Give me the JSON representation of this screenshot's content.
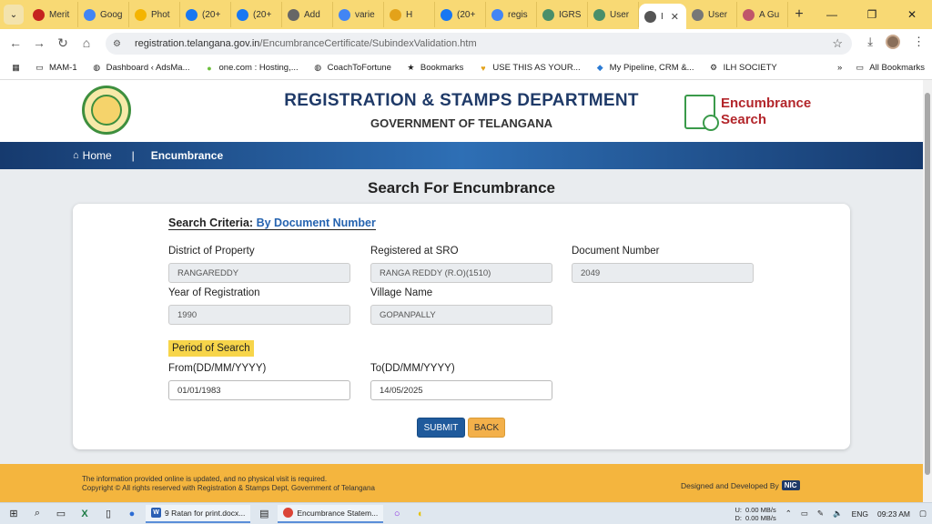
{
  "browser": {
    "tabs": [
      {
        "label": "Merit",
        "icon": "gmail-icon",
        "color": "#c5221f"
      },
      {
        "label": "Goog",
        "icon": "google-icon",
        "color": "#4285f4"
      },
      {
        "label": "Phot",
        "icon": "photos-icon",
        "color": "#f4b400"
      },
      {
        "label": "(20+",
        "icon": "facebook-icon",
        "color": "#1877f2"
      },
      {
        "label": "(20+",
        "icon": "facebook-icon",
        "color": "#1877f2"
      },
      {
        "label": "Add",
        "icon": "globe-icon",
        "color": "#666666"
      },
      {
        "label": "varie",
        "icon": "google-icon",
        "color": "#4285f4"
      },
      {
        "label": "H",
        "icon": "filter-icon",
        "color": "#e3a21a"
      },
      {
        "label": "(20+",
        "icon": "facebook-icon",
        "color": "#1877f2"
      },
      {
        "label": "regis",
        "icon": "google-icon",
        "color": "#4285f4"
      },
      {
        "label": "IGRS",
        "icon": "globe-icon",
        "color": "#4a8f6a"
      },
      {
        "label": "User",
        "icon": "globe-icon",
        "color": "#4a8f6a"
      },
      {
        "label": "I",
        "icon": "globe-icon",
        "color": "#555555",
        "active": true
      },
      {
        "label": "User",
        "icon": "loading-icon",
        "color": "#777777"
      },
      {
        "label": "A Gu",
        "icon": "globe-icon",
        "color": "#c0566a"
      }
    ],
    "url_domain": "registration.telangana.gov.in",
    "url_path": "/EncumbranceCertificate/SubindexValidation.htm",
    "bookmarks": [
      {
        "label": "MAM-1",
        "icon": "folder-icon"
      },
      {
        "label": "Dashboard ‹ AdsMa...",
        "icon": "globe-icon"
      },
      {
        "label": "one.com : Hosting,...",
        "icon": "circle-icon"
      },
      {
        "label": "CoachToFortune",
        "icon": "globe-icon"
      },
      {
        "label": "Bookmarks",
        "icon": "star-icon"
      },
      {
        "label": "USE THIS AS YOUR...",
        "icon": "bookmark-icon"
      },
      {
        "label": "My Pipeline, CRM &...",
        "icon": "pipeline-icon"
      },
      {
        "label": "ILH SOCIETY",
        "icon": "gear-icon"
      }
    ],
    "all_bookmarks": "All Bookmarks"
  },
  "header": {
    "dept": "REGISTRATION & STAMPS DEPARTMENT",
    "gov": "GOVERNMENT OF TELANGANA",
    "logo_line1": "Encumbrance",
    "logo_line2": "Search"
  },
  "nav": {
    "home": "Home",
    "separator": "|",
    "current": "Encumbrance"
  },
  "page_title": "Search For Encumbrance",
  "criteria": {
    "label": "Search Criteria:",
    "value": "By Document Number"
  },
  "fields": {
    "district_label": "District of Property",
    "district_value": "RANGAREDDY",
    "sro_label": "Registered at SRO",
    "sro_value": "RANGA REDDY (R.O)(1510)",
    "docnum_label": "Document Number",
    "docnum_value": "2049",
    "year_label": "Year of Registration",
    "year_value": "1990",
    "village_label": "Village Name",
    "village_value": "GOPANPALLY"
  },
  "period": {
    "label": "Period of Search",
    "from_label": "From(DD/MM/YYYY)",
    "from_value": "01/01/1983",
    "to_label": "To(DD/MM/YYYY)",
    "to_value": "14/05/2025"
  },
  "buttons": {
    "submit": "SUBMIT",
    "back": "BACK"
  },
  "footer": {
    "line1": "The information provided online is updated, and no physical visit is required.",
    "line2": "Copyright © All rights reserved with Registration & Stamps Dept, Government of Telangana",
    "designed": "Designed and Developed By",
    "nic": "NIC"
  },
  "taskbar": {
    "word_app": "9 Ratan for print.docx...",
    "chrome_app": "Encumbrance Statem...",
    "upload_label": "U:",
    "upload_speed": "0.00 MB/s",
    "download_label": "D:",
    "download_speed": "0.00 MB/s",
    "lang": "ENG",
    "time": "09:23 AM"
  },
  "colors": {
    "navy": "#1f3a68",
    "accent_yellow": "#f4b53e",
    "submit_blue": "#1f5a9c",
    "back_orange": "#f3b04a"
  }
}
